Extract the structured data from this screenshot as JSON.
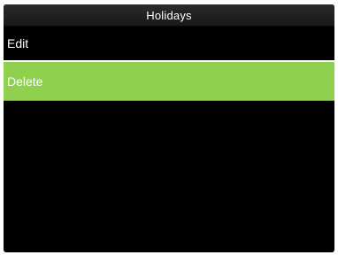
{
  "window": {
    "title": "Holidays"
  },
  "menu": {
    "items": [
      {
        "label": "Edit",
        "selected": false
      },
      {
        "label": "Delete",
        "selected": true
      }
    ]
  },
  "colors": {
    "background": "#000000",
    "selected_row": "#8fd14f",
    "text": "#ffffff"
  }
}
